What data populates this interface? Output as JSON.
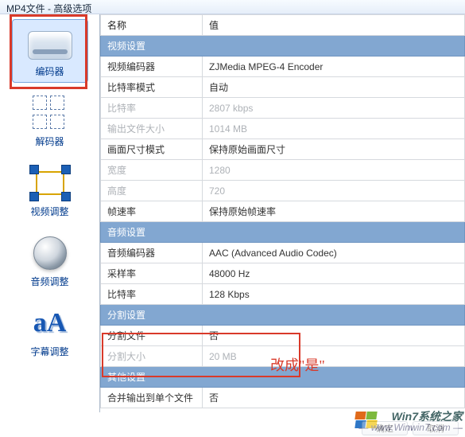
{
  "title": "MP4文件 - 高级选项",
  "sidebar": {
    "items": [
      {
        "label": "编码器"
      },
      {
        "label": "解码器"
      },
      {
        "label": "视频调整"
      },
      {
        "label": "音频调整"
      },
      {
        "label": "字幕调整"
      }
    ]
  },
  "table": {
    "head": {
      "k": "名称",
      "v": "值"
    },
    "groups": [
      {
        "title": "视频设置",
        "rows": [
          {
            "k": "视频编码器",
            "v": "ZJMedia MPEG-4 Encoder",
            "dis": false
          },
          {
            "k": "比特率模式",
            "v": "自动",
            "dis": false
          },
          {
            "k": "比特率",
            "v": "2807 kbps",
            "dis": true
          },
          {
            "k": "输出文件大小",
            "v": "1014 MB",
            "dis": true
          },
          {
            "k": "画面尺寸模式",
            "v": "保持原始画面尺寸",
            "dis": false
          },
          {
            "k": "宽度",
            "v": "1280",
            "dis": true
          },
          {
            "k": "高度",
            "v": "720",
            "dis": true
          },
          {
            "k": "帧速率",
            "v": "保持原始帧速率",
            "dis": false
          }
        ]
      },
      {
        "title": "音频设置",
        "rows": [
          {
            "k": "音频编码器",
            "v": "AAC (Advanced Audio Codec)",
            "dis": false
          },
          {
            "k": "采样率",
            "v": "48000 Hz",
            "dis": false
          },
          {
            "k": "比特率",
            "v": "128 Kbps",
            "dis": false
          }
        ]
      },
      {
        "title": "分割设置",
        "rows": [
          {
            "k": "分割文件",
            "v": "否",
            "dis": false
          },
          {
            "k": "分割大小",
            "v": "20 MB",
            "dis": true
          }
        ]
      },
      {
        "title": "其他设置",
        "rows": [
          {
            "k": "合并输出到单个文件",
            "v": "否",
            "dis": false
          }
        ]
      }
    ]
  },
  "annotation": "改成\"是\"",
  "buttons": {
    "ok": "确定",
    "cancel": "取消"
  },
  "watermark": {
    "line1": "Win7系统之家",
    "line2": "— www.Winwin7.com —"
  }
}
